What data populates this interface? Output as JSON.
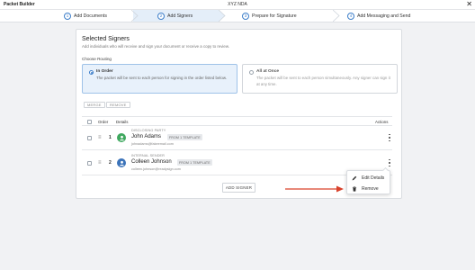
{
  "window": {
    "app_title": "Packet Builder",
    "doc_title": "XYZ NDA",
    "close_glyph": "✕"
  },
  "steps": [
    {
      "num": "1",
      "label": "Add Documents"
    },
    {
      "num": "2",
      "label": "Add Signers"
    },
    {
      "num": "3",
      "label": "Prepare for Signature"
    },
    {
      "num": "4",
      "label": "Add Messaging and Send"
    }
  ],
  "active_step": 2,
  "panel": {
    "title": "Selected Signers",
    "subtitle": "Add individuals who will receive and sign your document or receive a copy to review.",
    "routing_label": "Choose Routing",
    "routing": [
      {
        "title": "In Order",
        "desc": "The packet will be sent to each person for signing in the order listed below.",
        "selected": true
      },
      {
        "title": "All at Once",
        "desc": "The packet will be sent to each person simultaneously. Any signer can sign it at any time.",
        "selected": false
      }
    ],
    "merge_label": "MERGE",
    "remove_label": "REMOVE",
    "columns": {
      "order": "Order",
      "details": "Details",
      "actions": "Actions"
    },
    "drag_glyph": "≡",
    "signers": [
      {
        "order": "1",
        "role": "DISCLOSING PARTY",
        "name": "John Adams",
        "badge": "FROM 1 TEMPLATE",
        "email": "johnadams@fakeemail.com",
        "avatar_color": "#3fa85f",
        "avatar_icon": "user-check-icon"
      },
      {
        "order": "2",
        "role": "INTERNAL SENDER",
        "name": "Colleen Johnson",
        "badge": "FROM 1 TEMPLATE",
        "email": "colleen.johnson@readysign.com",
        "avatar_color": "#3b73b9",
        "avatar_icon": "user-icon"
      }
    ],
    "add_signer_label": "ADD SIGNER"
  },
  "menu": {
    "items": [
      {
        "label": "Edit Details",
        "icon": "pencil-icon"
      },
      {
        "label": "Remove",
        "icon": "trash-icon"
      }
    ]
  },
  "colors": {
    "accent": "#3d7ec9",
    "annotation_arrow": "#d9412b"
  }
}
